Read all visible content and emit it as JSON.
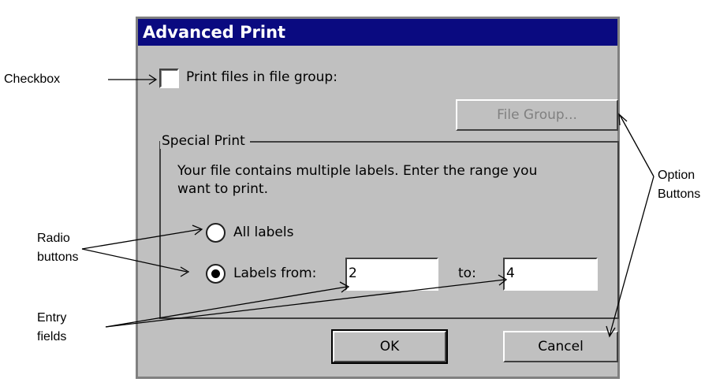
{
  "dialog": {
    "title": "Advanced Print",
    "checkbox_label": "Print files in file group:",
    "file_group_button": "File Group...",
    "special_print": {
      "title": "Special Print",
      "description_line1": "Your file contains multiple labels. Enter the range you",
      "description_line2": "want to print.",
      "radio_all_label": "All labels",
      "radio_range_label": "Labels from:",
      "from_value": "2",
      "to_label": "to:",
      "to_value": "4"
    },
    "ok_button": "OK",
    "cancel_button": "Cancel"
  },
  "callouts": {
    "checkbox": "Checkbox",
    "radio_line1": "Radio",
    "radio_line2": "buttons",
    "entry_line1": "Entry",
    "entry_line2": "fields",
    "option_line1": "Option",
    "option_line2": "Buttons"
  },
  "state": {
    "checkbox_checked": false,
    "selected_radio": "range"
  },
  "colors": {
    "titlebar": "#0a0a80",
    "dialog_bg": "#c0c0c0",
    "disabled_text": "#808080"
  }
}
